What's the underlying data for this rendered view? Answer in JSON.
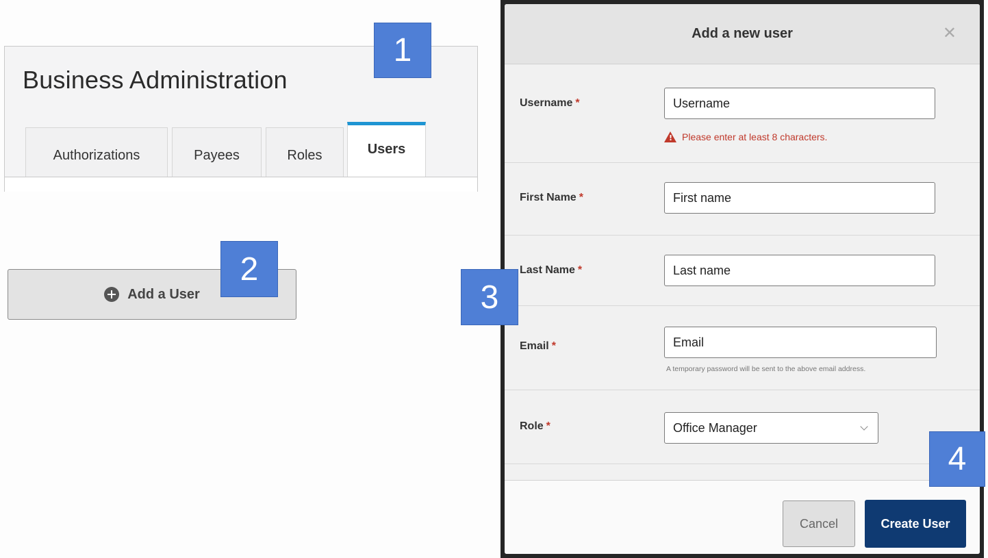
{
  "admin_panel": {
    "title": "Business Administration",
    "tabs": [
      {
        "label": "Authorizations"
      },
      {
        "label": "Payees"
      },
      {
        "label": "Roles"
      },
      {
        "label": "Users",
        "active": true
      }
    ]
  },
  "add_user_button": {
    "label": "Add a User",
    "icon": "plus-circle-icon"
  },
  "markers": [
    "1",
    "2",
    "3",
    "4"
  ],
  "modal": {
    "title": "Add a new user",
    "close_icon": "close-icon",
    "fields": {
      "username": {
        "label": "Username",
        "required": "*",
        "placeholder": "Username",
        "error": "Please enter at least 8 characters."
      },
      "first_name": {
        "label": "First Name",
        "required": "*",
        "placeholder": "First name"
      },
      "last_name": {
        "label": "Last Name",
        "required": "*",
        "placeholder": "Last name"
      },
      "email": {
        "label": "Email",
        "required": "*",
        "placeholder": "Email",
        "helper": "A temporary password will be sent to the above email address."
      },
      "role": {
        "label": "Role",
        "required": "*",
        "selected": "Office Manager"
      }
    },
    "buttons": {
      "cancel": "Cancel",
      "create": "Create User"
    }
  },
  "colors": {
    "tab_active_accent": "#1e95d3",
    "marker_bg": "#4f7fd6",
    "required_red": "#c0392b",
    "primary_button": "#0f3a72"
  }
}
